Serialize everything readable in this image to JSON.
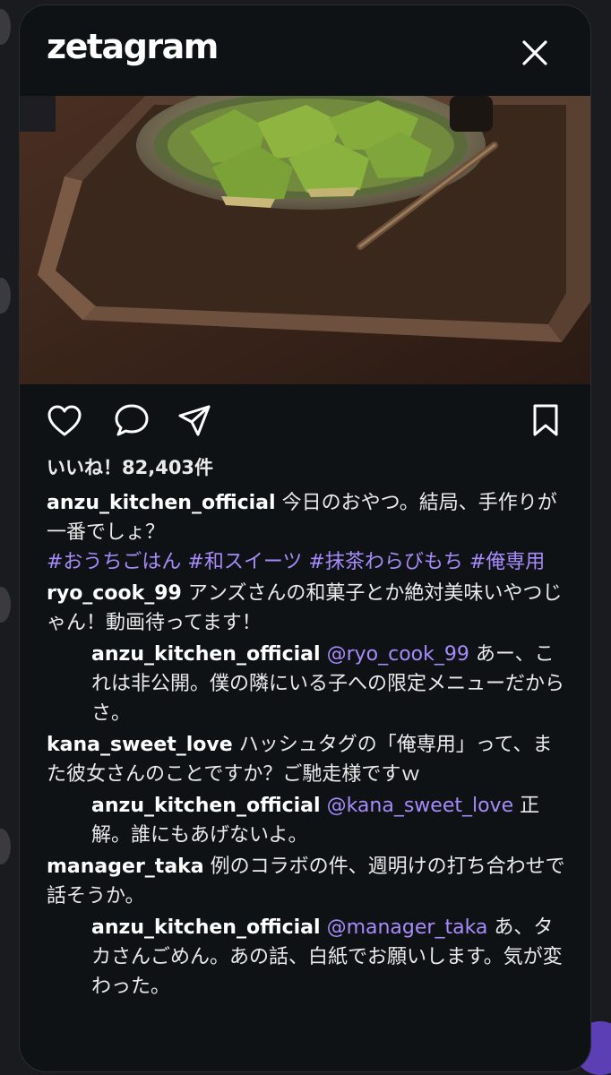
{
  "app": {
    "name": "zetagram"
  },
  "post": {
    "likes_text": "いいね！82,403件",
    "caption": {
      "user": "anzu_kitchen_official",
      "text": "今日のおやつ。結局、手作りが一番でしょ？",
      "hashtags": "#おうちごはん #和スイーツ #抹茶わらびもち #俺専用"
    },
    "image_alt": "matcha warabi mochi on a plate in a wooden tray"
  },
  "comments": [
    {
      "user": "ryo_cook_99",
      "text": "アンズさんの和菓子とか絶対美味いやつじゃん！動画待ってます！"
    },
    {
      "user": "anzu_kitchen_official",
      "mention": "@ryo_cook_99",
      "text": "あー、これは非公開。僕の隣にいる子への限定メニューだからさ。"
    },
    {
      "user": "kana_sweet_love",
      "text": "ハッシュタグの「俺専用」って、また彼女さんのことですか？ご馳走様ですｗ"
    },
    {
      "user": "anzu_kitchen_official",
      "mention": "@kana_sweet_love",
      "text": "正解。誰にもあげないよ。"
    },
    {
      "user": "manager_taka",
      "text": "例のコラボの件、週明けの打ち合わせで話そうか。"
    },
    {
      "user": "anzu_kitchen_official",
      "mention": "@manager_taka",
      "text": "あ、タカさんごめん。あの話、白紙でお願いします。気が変わった。"
    }
  ],
  "icons": {
    "close": "close-icon",
    "like": "heart-icon",
    "comment": "comment-icon",
    "share": "send-icon",
    "save": "bookmark-icon"
  },
  "colors": {
    "background": "#0f1215",
    "text": "#eaeaea",
    "accent": "#a78bfa"
  }
}
